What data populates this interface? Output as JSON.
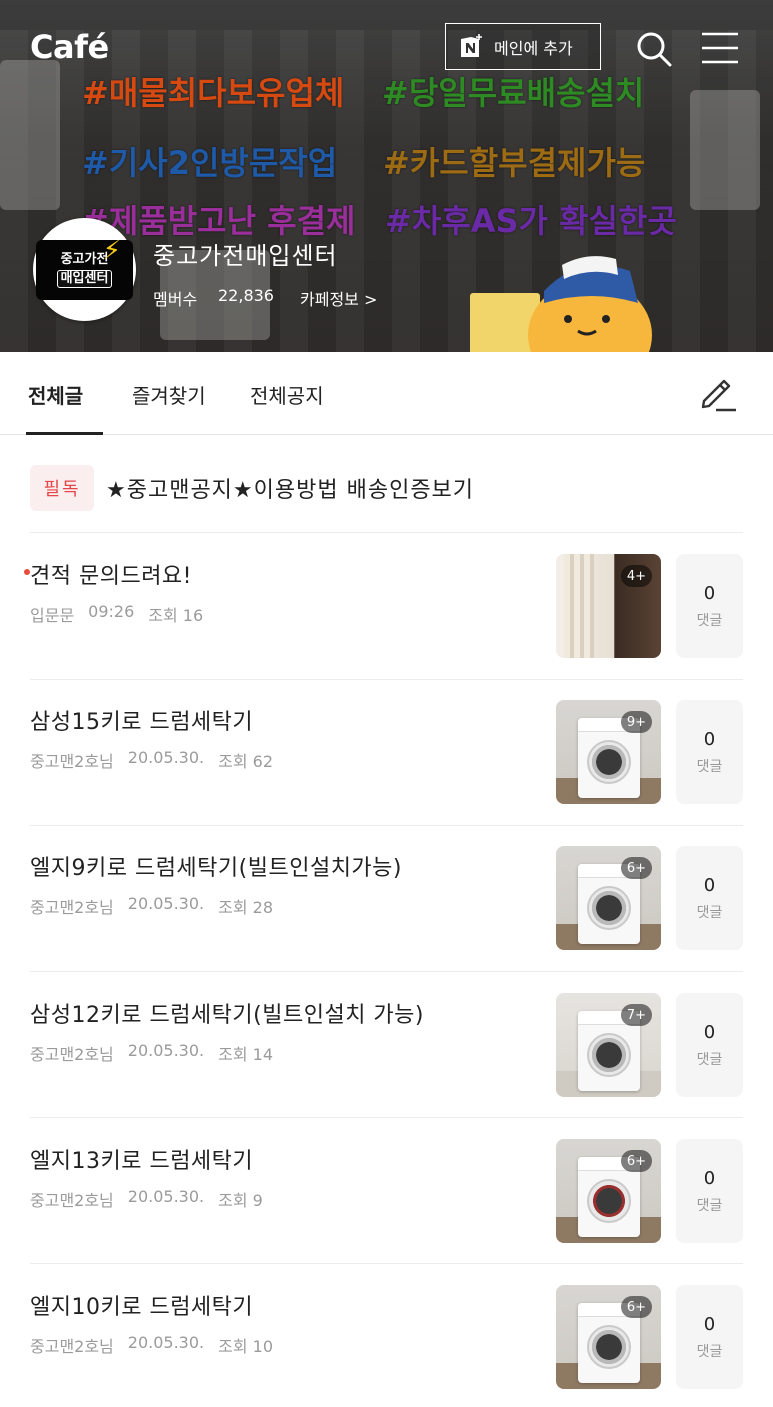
{
  "header": {
    "logo": "Café",
    "add_main_label": "메인에 추가",
    "add_main_icon": "naver-n-plus-icon",
    "search_icon": "search-icon",
    "menu_icon": "hamburger-menu-icon"
  },
  "banner": {
    "taglines": [
      "#매물최다보유업체",
      "#당일무료배송설치",
      "#기사2인방문작업",
      "#카드할부결제가능",
      "#제품받고난 후결제",
      "#차후AS가 확실한곳"
    ],
    "avatar_line1": "중고가전",
    "avatar_line2": "매입센터"
  },
  "cafe": {
    "name": "중고가전매입센터",
    "member_label": "멤버수",
    "member_count": "22,836",
    "info_label": "카페정보 >"
  },
  "tabs": {
    "all": "전체글",
    "favorites": "즐겨찾기",
    "notice": "전체공지",
    "active": "all"
  },
  "pinned": {
    "badge": "필독",
    "title": "★중고맨공지★이용방법 배송인증보기"
  },
  "posts": [
    {
      "title": "견적 문의드려요!",
      "author": "입문문",
      "date": "09:26",
      "views": "조회 16",
      "photo_count": "4+",
      "comments": "0",
      "comment_label": "댓글",
      "is_new": true
    },
    {
      "title": "삼성15키로 드럼세탁기",
      "author": "중고맨2호님",
      "date": "20.05.30.",
      "views": "조회 62",
      "photo_count": "9+",
      "comments": "0",
      "comment_label": "댓글",
      "is_new": false
    },
    {
      "title": "엘지9키로 드럼세탁기(빌트인설치가능)",
      "author": "중고맨2호님",
      "date": "20.05.30.",
      "views": "조회 28",
      "photo_count": "6+",
      "comments": "0",
      "comment_label": "댓글",
      "is_new": false
    },
    {
      "title": "삼성12키로 드럼세탁기(빌트인설치 가능)",
      "author": "중고맨2호님",
      "date": "20.05.30.",
      "views": "조회 14",
      "photo_count": "7+",
      "comments": "0",
      "comment_label": "댓글",
      "is_new": false
    },
    {
      "title": "엘지13키로 드럼세탁기",
      "author": "중고맨2호님",
      "date": "20.05.30.",
      "views": "조회 9",
      "photo_count": "6+",
      "comments": "0",
      "comment_label": "댓글",
      "is_new": false
    },
    {
      "title": "엘지10키로 드럼세탁기",
      "author": "중고맨2호님",
      "date": "20.05.30.",
      "views": "조회 10",
      "photo_count": "6+",
      "comments": "0",
      "comment_label": "댓글",
      "is_new": false
    }
  ],
  "colors": {
    "pin_badge_bg": "#fbeeee",
    "pin_badge_text": "#e5464a",
    "new_dot": "#e94b3c",
    "meta_text": "#9b9b9b"
  }
}
